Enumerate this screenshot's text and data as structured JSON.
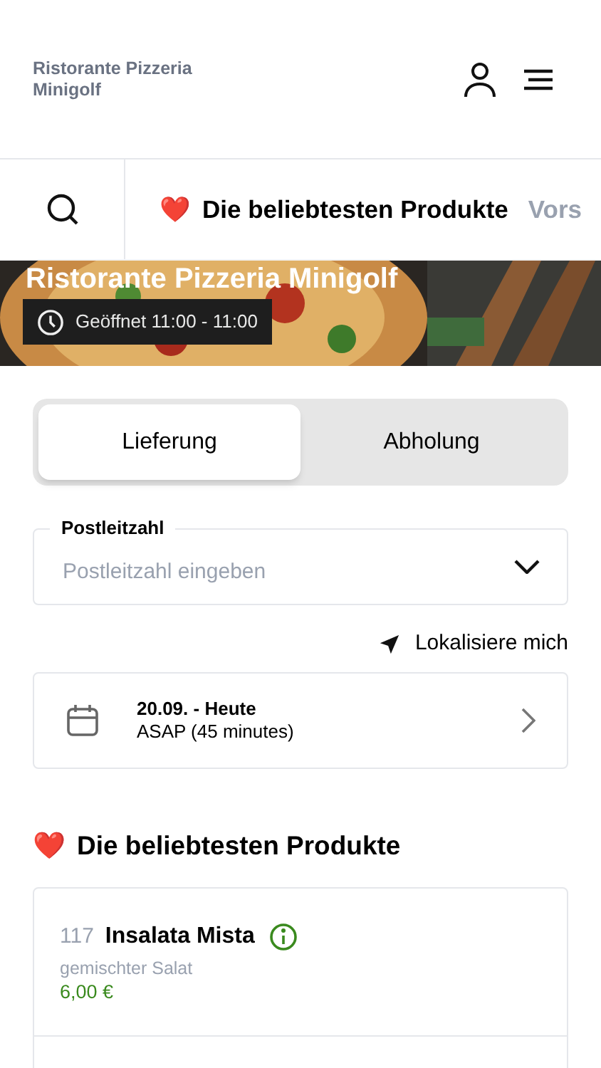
{
  "header": {
    "title": "Ristorante Pizzeria Minigolf"
  },
  "category_tabs": [
    {
      "label": "Die beliebtesten Produkte",
      "emoji": "❤️",
      "selected": true
    },
    {
      "label": "Vors",
      "selected": false
    }
  ],
  "hero": {
    "kind": "picture",
    "title": "Ristorante Pizzeria Minigolf",
    "hours": "Geöffnet 11:00 - 11:00"
  },
  "order_mode": [
    {
      "label": "Lieferung",
      "selected": true
    },
    {
      "label": "Abholung",
      "selected": false
    }
  ],
  "postcode": {
    "label": "Postleitzahl",
    "placeholder": "Postleitzahl eingeben"
  },
  "locate_link": "Lokalisiere mich",
  "schedule": {
    "date": "20.09. - Heute",
    "time": "ASAP (45 minutes)"
  },
  "section": {
    "emoji": "❤️",
    "title": "Die beliebtesten Produkte"
  },
  "products": [
    {
      "number": "117",
      "name": "Insalata Mista",
      "description": "gemischter Salat",
      "price": "6,00 €"
    }
  ]
}
